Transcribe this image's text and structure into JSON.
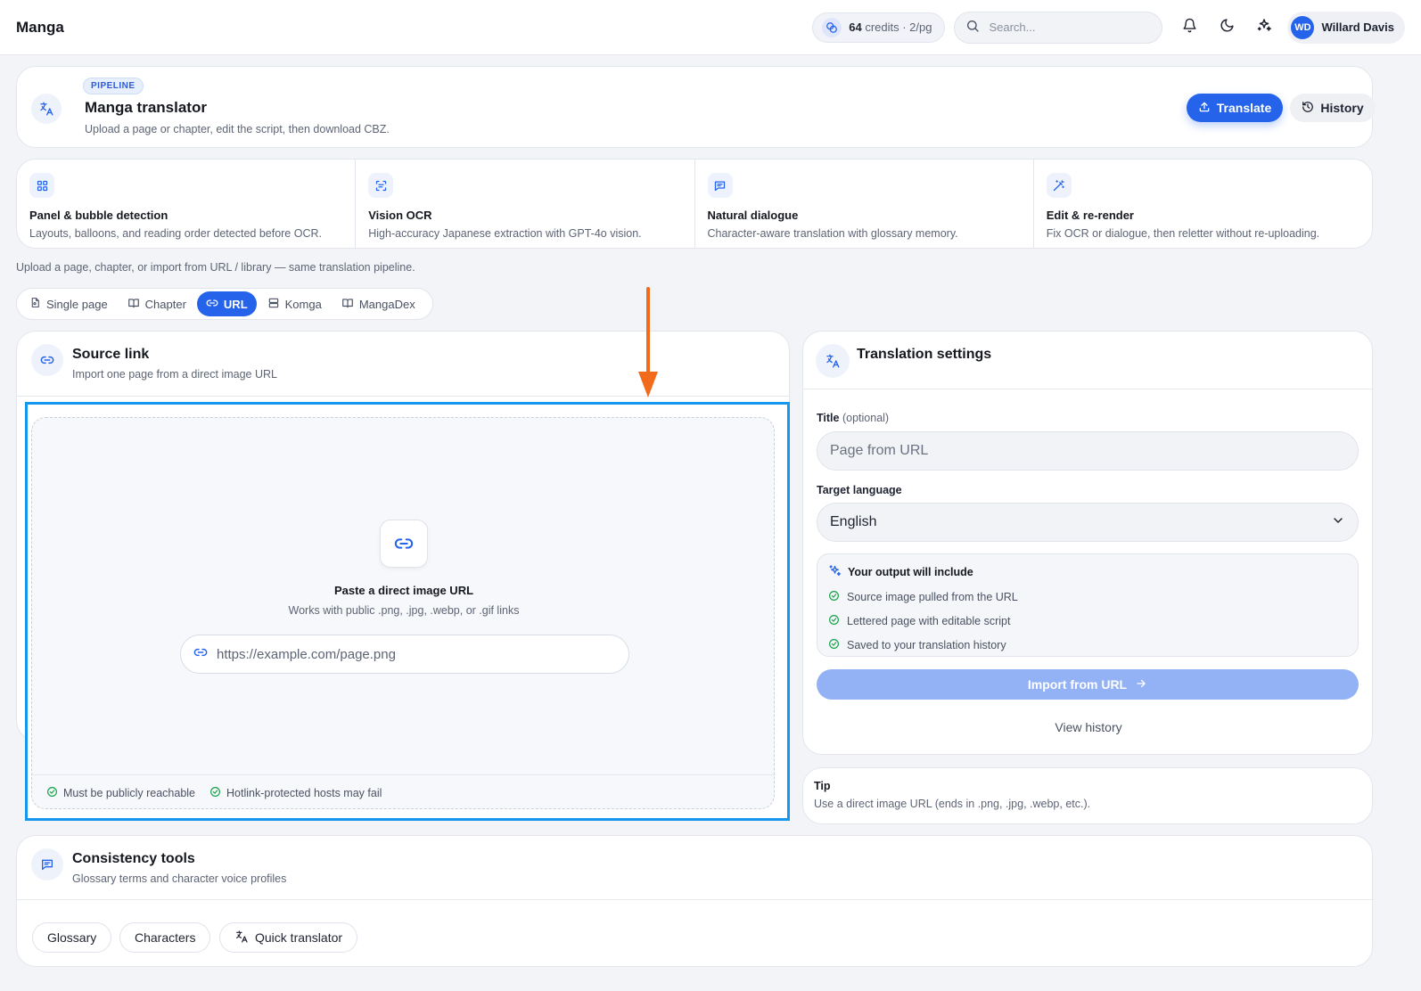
{
  "topbar": {
    "brand": "Manga",
    "credits_count": "64",
    "credits_suffix": "credits · 2/pg",
    "search_placeholder": "Search...",
    "user_initials": "WD",
    "user_name": "Willard Davis"
  },
  "hero": {
    "tag": "PIPELINE",
    "title": "Manga translator",
    "subtitle": "Upload a page or chapter, edit the script, then download CBZ.",
    "translate_label": "Translate",
    "history_label": "History"
  },
  "features": [
    {
      "title": "Panel & bubble detection",
      "desc": "Layouts, balloons, and reading order detected before OCR.",
      "icon": "grid-icon"
    },
    {
      "title": "Vision OCR",
      "desc": "High-accuracy Japanese extraction with GPT-4o vision.",
      "icon": "scan-icon"
    },
    {
      "title": "Natural dialogue",
      "desc": "Character-aware translation with glossary memory.",
      "icon": "message-icon"
    },
    {
      "title": "Edit & re-render",
      "desc": "Fix OCR or dialogue, then reletter without re-uploading.",
      "icon": "wand-icon"
    }
  ],
  "intro_text": "Upload a page, chapter, or import from URL / library — same translation pipeline.",
  "tabs": [
    {
      "label": "Single page",
      "icon": "file-icon",
      "active": false
    },
    {
      "label": "Chapter",
      "icon": "book-icon",
      "active": false
    },
    {
      "label": "URL",
      "icon": "link-icon",
      "active": true
    },
    {
      "label": "Komga",
      "icon": "server-icon",
      "active": false
    },
    {
      "label": "MangaDex",
      "icon": "book-open-icon",
      "active": false
    }
  ],
  "source": {
    "title": "Source link",
    "subtitle": "Import one page from a direct image URL",
    "drop_title": "Paste a direct image URL",
    "drop_subtitle": "Works with public .png, .jpg, .webp, or .gif links",
    "url_placeholder": "https://example.com/page.png",
    "notes": [
      "Must be publicly reachable",
      "Hotlink-protected hosts may fail"
    ]
  },
  "settings": {
    "title": "Translation settings",
    "title_label": "Title",
    "title_optional": "(optional)",
    "title_placeholder": "Page from URL",
    "language_label": "Target language",
    "language_value": "English",
    "output_title": "Your output will include",
    "output_items": [
      "Source image pulled from the URL",
      "Lettered page with editable script",
      "Saved to your translation history"
    ],
    "import_label": "Import from URL",
    "view_history": "View history"
  },
  "tip": {
    "title": "Tip",
    "text": "Use a direct image URL (ends in .png, .jpg, .webp, etc.)."
  },
  "consistency": {
    "title": "Consistency tools",
    "subtitle": "Glossary terms and character voice profiles",
    "chips": [
      "Glossary",
      "Characters",
      "Quick translator"
    ]
  },
  "colors": {
    "accent": "#2563eb",
    "highlight_frame": "#1597ee",
    "annotation_arrow": "#f26a1b",
    "success": "#16a34a"
  }
}
